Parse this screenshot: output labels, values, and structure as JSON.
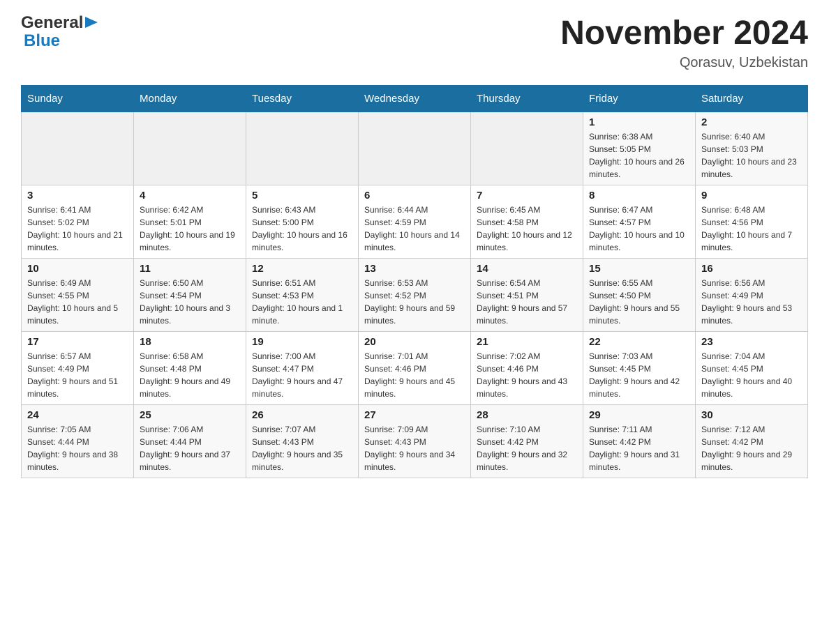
{
  "header": {
    "logo_general": "General",
    "logo_blue": "Blue",
    "month_title": "November 2024",
    "location": "Qorasuv, Uzbekistan"
  },
  "weekdays": [
    "Sunday",
    "Monday",
    "Tuesday",
    "Wednesday",
    "Thursday",
    "Friday",
    "Saturday"
  ],
  "weeks": [
    [
      {
        "day": "",
        "info": ""
      },
      {
        "day": "",
        "info": ""
      },
      {
        "day": "",
        "info": ""
      },
      {
        "day": "",
        "info": ""
      },
      {
        "day": "",
        "info": ""
      },
      {
        "day": "1",
        "info": "Sunrise: 6:38 AM\nSunset: 5:05 PM\nDaylight: 10 hours and 26 minutes."
      },
      {
        "day": "2",
        "info": "Sunrise: 6:40 AM\nSunset: 5:03 PM\nDaylight: 10 hours and 23 minutes."
      }
    ],
    [
      {
        "day": "3",
        "info": "Sunrise: 6:41 AM\nSunset: 5:02 PM\nDaylight: 10 hours and 21 minutes."
      },
      {
        "day": "4",
        "info": "Sunrise: 6:42 AM\nSunset: 5:01 PM\nDaylight: 10 hours and 19 minutes."
      },
      {
        "day": "5",
        "info": "Sunrise: 6:43 AM\nSunset: 5:00 PM\nDaylight: 10 hours and 16 minutes."
      },
      {
        "day": "6",
        "info": "Sunrise: 6:44 AM\nSunset: 4:59 PM\nDaylight: 10 hours and 14 minutes."
      },
      {
        "day": "7",
        "info": "Sunrise: 6:45 AM\nSunset: 4:58 PM\nDaylight: 10 hours and 12 minutes."
      },
      {
        "day": "8",
        "info": "Sunrise: 6:47 AM\nSunset: 4:57 PM\nDaylight: 10 hours and 10 minutes."
      },
      {
        "day": "9",
        "info": "Sunrise: 6:48 AM\nSunset: 4:56 PM\nDaylight: 10 hours and 7 minutes."
      }
    ],
    [
      {
        "day": "10",
        "info": "Sunrise: 6:49 AM\nSunset: 4:55 PM\nDaylight: 10 hours and 5 minutes."
      },
      {
        "day": "11",
        "info": "Sunrise: 6:50 AM\nSunset: 4:54 PM\nDaylight: 10 hours and 3 minutes."
      },
      {
        "day": "12",
        "info": "Sunrise: 6:51 AM\nSunset: 4:53 PM\nDaylight: 10 hours and 1 minute."
      },
      {
        "day": "13",
        "info": "Sunrise: 6:53 AM\nSunset: 4:52 PM\nDaylight: 9 hours and 59 minutes."
      },
      {
        "day": "14",
        "info": "Sunrise: 6:54 AM\nSunset: 4:51 PM\nDaylight: 9 hours and 57 minutes."
      },
      {
        "day": "15",
        "info": "Sunrise: 6:55 AM\nSunset: 4:50 PM\nDaylight: 9 hours and 55 minutes."
      },
      {
        "day": "16",
        "info": "Sunrise: 6:56 AM\nSunset: 4:49 PM\nDaylight: 9 hours and 53 minutes."
      }
    ],
    [
      {
        "day": "17",
        "info": "Sunrise: 6:57 AM\nSunset: 4:49 PM\nDaylight: 9 hours and 51 minutes."
      },
      {
        "day": "18",
        "info": "Sunrise: 6:58 AM\nSunset: 4:48 PM\nDaylight: 9 hours and 49 minutes."
      },
      {
        "day": "19",
        "info": "Sunrise: 7:00 AM\nSunset: 4:47 PM\nDaylight: 9 hours and 47 minutes."
      },
      {
        "day": "20",
        "info": "Sunrise: 7:01 AM\nSunset: 4:46 PM\nDaylight: 9 hours and 45 minutes."
      },
      {
        "day": "21",
        "info": "Sunrise: 7:02 AM\nSunset: 4:46 PM\nDaylight: 9 hours and 43 minutes."
      },
      {
        "day": "22",
        "info": "Sunrise: 7:03 AM\nSunset: 4:45 PM\nDaylight: 9 hours and 42 minutes."
      },
      {
        "day": "23",
        "info": "Sunrise: 7:04 AM\nSunset: 4:45 PM\nDaylight: 9 hours and 40 minutes."
      }
    ],
    [
      {
        "day": "24",
        "info": "Sunrise: 7:05 AM\nSunset: 4:44 PM\nDaylight: 9 hours and 38 minutes."
      },
      {
        "day": "25",
        "info": "Sunrise: 7:06 AM\nSunset: 4:44 PM\nDaylight: 9 hours and 37 minutes."
      },
      {
        "day": "26",
        "info": "Sunrise: 7:07 AM\nSunset: 4:43 PM\nDaylight: 9 hours and 35 minutes."
      },
      {
        "day": "27",
        "info": "Sunrise: 7:09 AM\nSunset: 4:43 PM\nDaylight: 9 hours and 34 minutes."
      },
      {
        "day": "28",
        "info": "Sunrise: 7:10 AM\nSunset: 4:42 PM\nDaylight: 9 hours and 32 minutes."
      },
      {
        "day": "29",
        "info": "Sunrise: 7:11 AM\nSunset: 4:42 PM\nDaylight: 9 hours and 31 minutes."
      },
      {
        "day": "30",
        "info": "Sunrise: 7:12 AM\nSunset: 4:42 PM\nDaylight: 9 hours and 29 minutes."
      }
    ]
  ]
}
